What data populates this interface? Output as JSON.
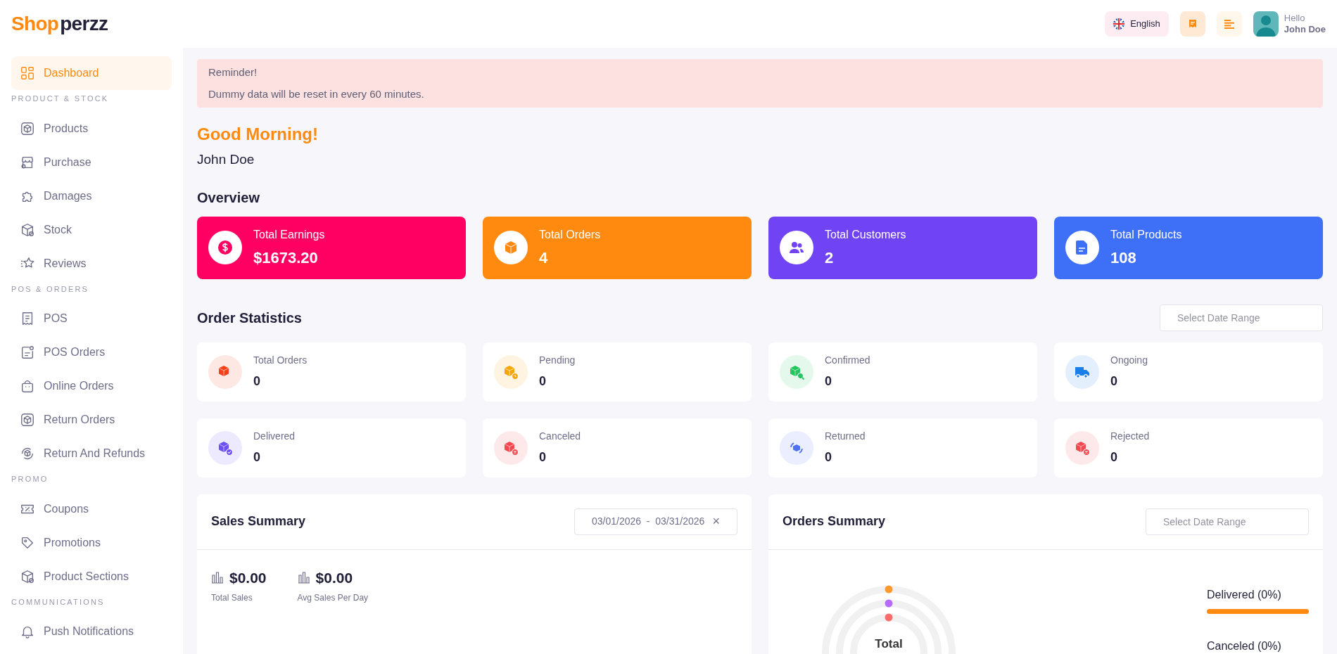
{
  "header": {
    "logo": {
      "accent": "Shop",
      "rest": "perzz"
    },
    "language": "English",
    "user": {
      "greeting": "Hello",
      "name": "John Doe"
    }
  },
  "sidebar": {
    "sections": [
      {
        "items": [
          {
            "label": "Dashboard",
            "kind": "grid",
            "selected": true
          }
        ]
      },
      {
        "title": "PRODUCT & STOCK",
        "items": [
          {
            "label": "Products",
            "kind": "box",
            "selected": false
          },
          {
            "label": "Purchase",
            "kind": "store",
            "selected": false
          },
          {
            "label": "Damages",
            "kind": "puzzle",
            "selected": false
          },
          {
            "label": "Stock",
            "kind": "cube",
            "selected": false
          },
          {
            "label": "Reviews",
            "kind": "star",
            "selected": false
          }
        ]
      },
      {
        "title": "POS & ORDERS",
        "items": [
          {
            "label": "POS",
            "kind": "receipt",
            "selected": false
          },
          {
            "label": "POS Orders",
            "kind": "note",
            "selected": false
          },
          {
            "label": "Online Orders",
            "kind": "bag",
            "selected": false
          },
          {
            "label": "Return Orders",
            "kind": "box",
            "selected": false
          },
          {
            "label": "Return And Refunds",
            "kind": "refund",
            "selected": false
          }
        ]
      },
      {
        "title": "PROMO",
        "items": [
          {
            "label": "Coupons",
            "kind": "ticket",
            "selected": false
          },
          {
            "label": "Promotions",
            "kind": "tag",
            "selected": false
          },
          {
            "label": "Product Sections",
            "kind": "cube",
            "selected": false
          }
        ]
      },
      {
        "title": "COMMUNICATIONS",
        "items": [
          {
            "label": "Push Notifications",
            "kind": "bell",
            "selected": false
          }
        ]
      }
    ]
  },
  "reminder": {
    "title": "Reminder!",
    "text": "Dummy data will be reset in every 60 minutes."
  },
  "greeting": {
    "title": "Good Morning!",
    "name": "John Doe"
  },
  "overview": {
    "title": "Overview",
    "cards": [
      {
        "label": "Total Earnings",
        "value": "$1673.20",
        "kind": "dollar",
        "color": "#ff0062"
      },
      {
        "label": "Total Orders",
        "value": "4",
        "kind": "box",
        "color": "#ff8a0f"
      },
      {
        "label": "Total Customers",
        "value": "2",
        "kind": "users",
        "color": "#7043f5"
      },
      {
        "label": "Total Products",
        "value": "108",
        "kind": "file",
        "color": "#3d6ff7"
      }
    ]
  },
  "order_statistics": {
    "title": "Order Statistics",
    "date_placeholder": "Select Date Range",
    "cards": [
      {
        "label": "Total Orders",
        "value": "0",
        "kind": "box",
        "color": "#f5401b"
      },
      {
        "label": "Pending",
        "value": "0",
        "kind": "box-clock",
        "color": "#f5a70a"
      },
      {
        "label": "Confirmed",
        "value": "0",
        "kind": "box-search",
        "color": "#22c55e"
      },
      {
        "label": "Ongoing",
        "value": "0",
        "kind": "truck",
        "color": "#1a7fe8"
      },
      {
        "label": "Delivered",
        "value": "0",
        "kind": "box-check",
        "color": "#6d4df5"
      },
      {
        "label": "Canceled",
        "value": "0",
        "kind": "box-x",
        "color": "#f4474f"
      },
      {
        "label": "Returned",
        "value": "0",
        "kind": "box-return",
        "color": "#4f72f5"
      },
      {
        "label": "Rejected",
        "value": "0",
        "kind": "box-x",
        "color": "#f4474f"
      }
    ]
  },
  "sales_summary": {
    "title": "Sales Summary",
    "date_from": "03/01/2026",
    "date_separator": "-",
    "date_to": "03/31/2026",
    "clear": "×",
    "stats": [
      {
        "value": "$0.00",
        "label": "Total Sales"
      },
      {
        "value": "$0.00",
        "label": "Avg Sales Per Day"
      }
    ]
  },
  "orders_summary": {
    "title": "Orders Summary",
    "date_placeholder": "Select Date Range",
    "chart_center": "Total",
    "legend": [
      {
        "label": "Delivered (0%)",
        "color": "#ff8a0f"
      },
      {
        "label": "Canceled (0%)"
      }
    ]
  }
}
